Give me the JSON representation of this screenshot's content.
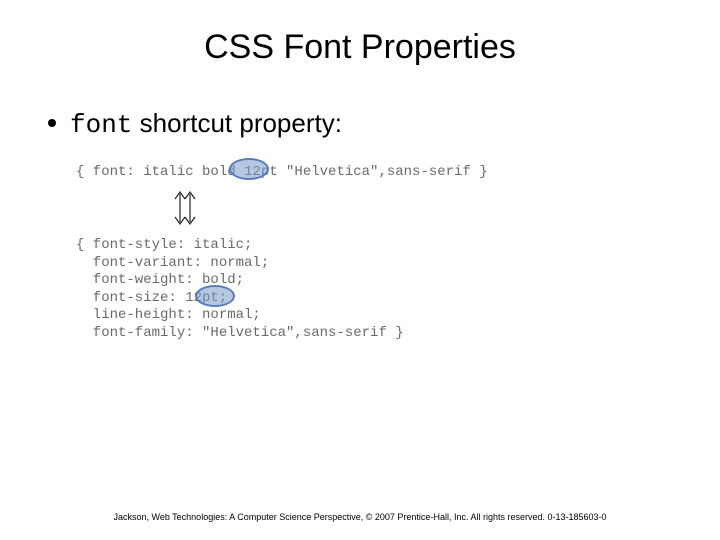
{
  "title": "CSS Font Properties",
  "bullet": {
    "code_word": "font",
    "rest": " shortcut property:"
  },
  "code": {
    "shorthand": "{ font: italic bold 12pt \"Helvetica\",sans-serif }",
    "expanded": "{ font-style: italic;\n  font-variant: normal;\n  font-weight: bold;\n  font-size: 12pt;\n  line-height: normal;\n  font-family: \"Helvetica\",sans-serif }"
  },
  "highlight": {
    "value": "12pt"
  },
  "footer": "Jackson, Web Technologies: A Computer Science Perspective, © 2007 Prentice-Hall, Inc. All rights reserved. 0-13-185603-0"
}
